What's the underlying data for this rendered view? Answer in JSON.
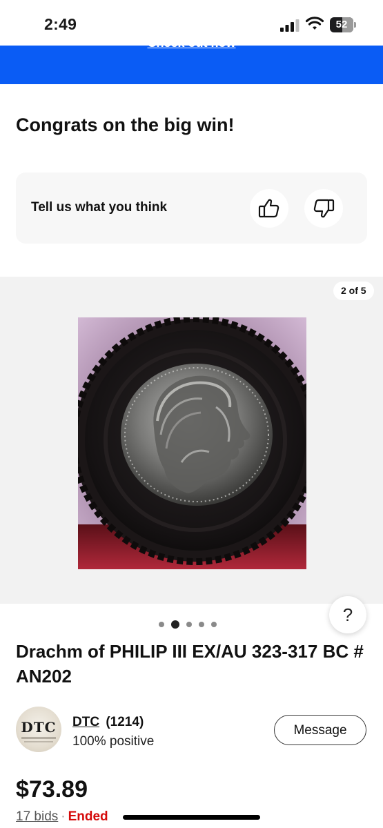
{
  "status_bar": {
    "time": "2:49",
    "battery_level": "52",
    "icons": [
      "signal-icon",
      "wifi-icon",
      "battery-icon"
    ]
  },
  "banner": {
    "link_text": "Check out now",
    "color": "#0a5cf5"
  },
  "congrats_heading": "Congrats on the big win!",
  "feedback": {
    "prompt": "Tell us what you think",
    "icons": [
      "thumbs-up-icon",
      "thumbs-down-icon"
    ]
  },
  "gallery": {
    "counter": "2 of 5",
    "current_index": 2,
    "total": 5
  },
  "help_button": "?",
  "item": {
    "title": "Drachm of PHILIP III EX/AU 323-317 BC # AN202",
    "price": "$73.89",
    "bids": "17 bids",
    "separator": "·",
    "status": "Ended",
    "status_color": "#d50b0b"
  },
  "seller": {
    "avatar_text": "DTC",
    "name": "DTC",
    "score": "(1214)",
    "positive": "100% positive",
    "message_label": "Message"
  }
}
